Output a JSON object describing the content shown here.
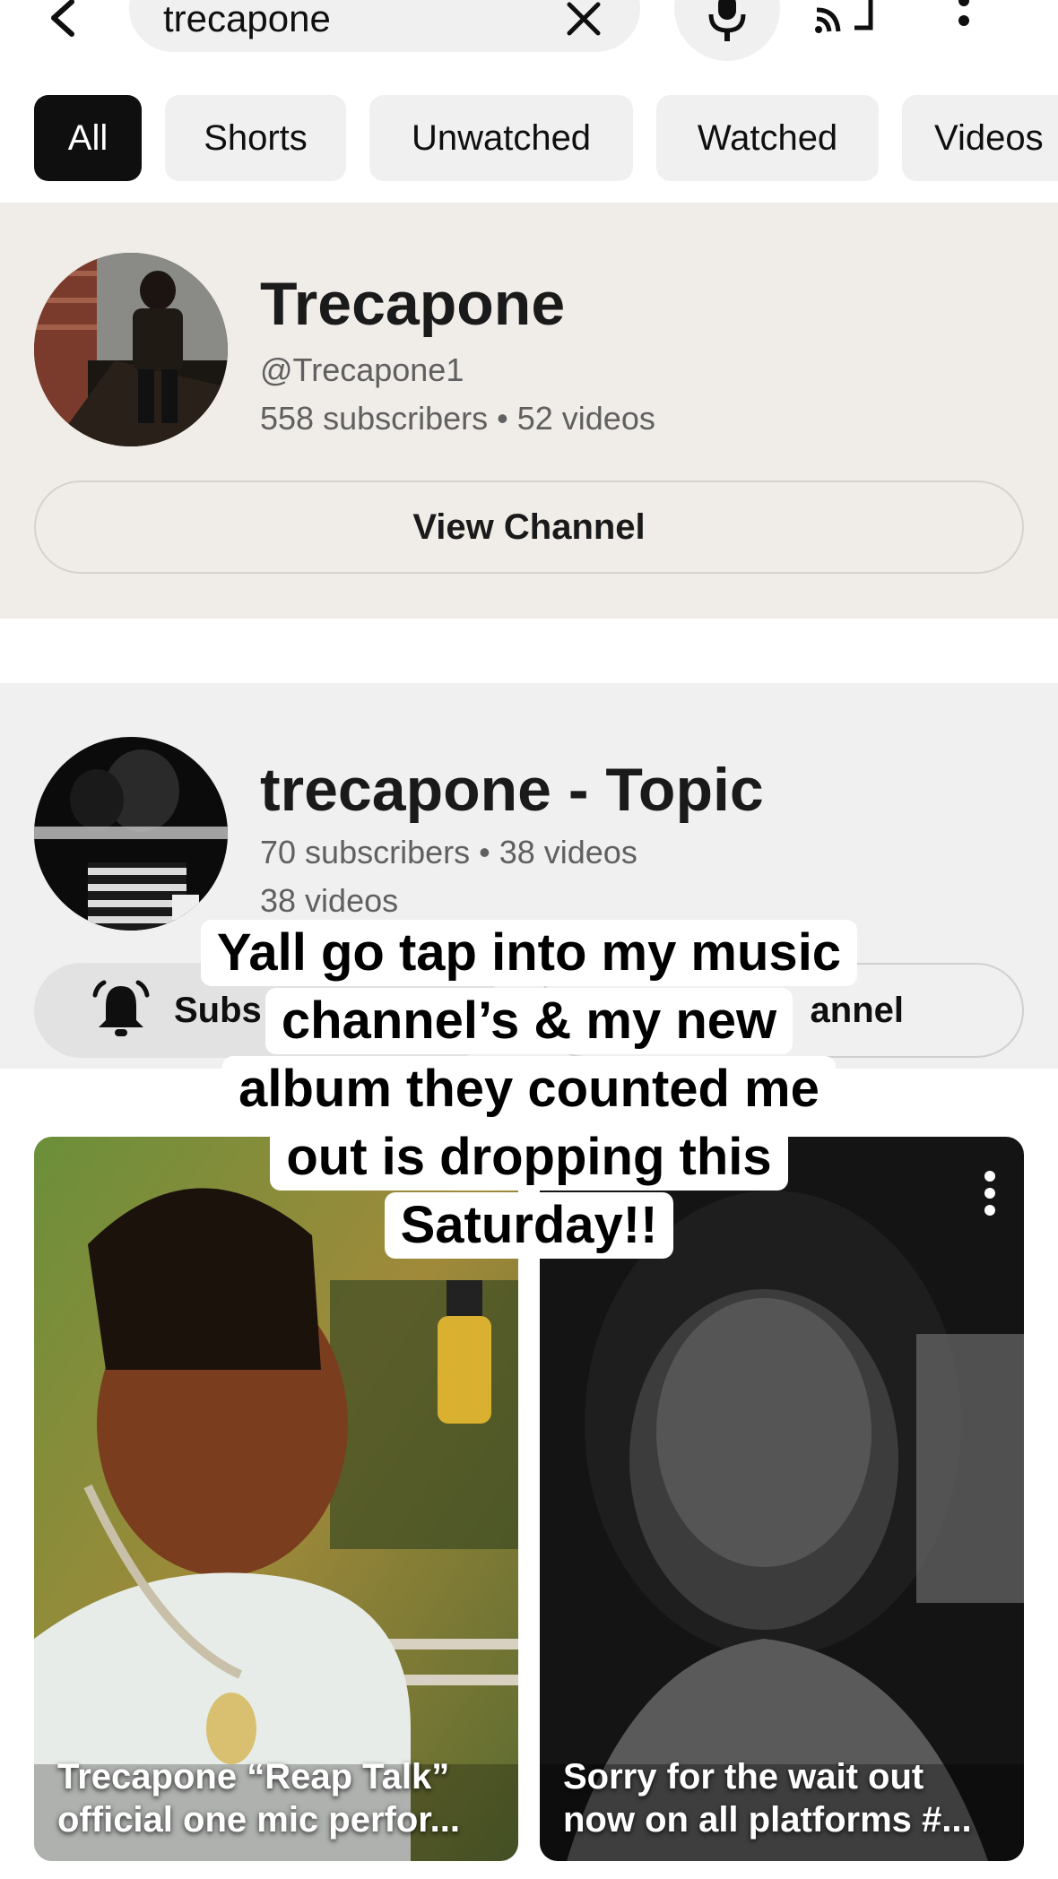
{
  "search": {
    "query": "trecapone"
  },
  "chips": [
    "All",
    "Shorts",
    "Unwatched",
    "Watched",
    "Videos"
  ],
  "channel1": {
    "name": "Trecapone",
    "handle": "@Trecapone1",
    "stats": "558 subscribers • 52 videos",
    "view_label": "View Channel"
  },
  "channel2": {
    "name": "trecapone - Topic",
    "stats": "70 subscribers • 38 videos",
    "videos": "38 videos",
    "subscribe_label": "Subs",
    "view_label": "annel"
  },
  "caption_lines": [
    "Yall go tap into my music",
    "channel’s & my new",
    "album they counted me",
    "out is dropping this",
    "Saturday!!"
  ],
  "shorts": [
    {
      "title": "Trecapone “Reap Talk” official one mic perfor..."
    },
    {
      "title": "Sorry for the wait out now on all platforms #..."
    }
  ]
}
